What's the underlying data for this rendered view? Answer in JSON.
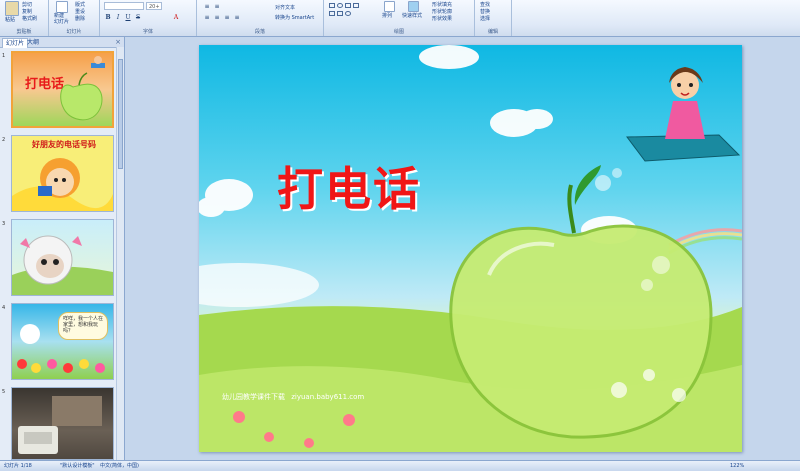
{
  "ribbon": {
    "clipboard": {
      "paste": "粘贴",
      "cut": "剪切",
      "copy": "复制",
      "format_painter": "格式刷",
      "group": "剪贴板"
    },
    "slides": {
      "new_slide": "新建\n幻灯片",
      "layout": "版式",
      "reset": "重设",
      "delete": "删除",
      "group": "幻灯片"
    },
    "font": {
      "font_size": "20+",
      "group": "字体"
    },
    "paragraph": {
      "align_text": "对齐文本",
      "smartart": "转换为 SmartArt",
      "group": "段落"
    },
    "drawing": {
      "arrange": "排列",
      "quick_styles": "快速样式",
      "shape_fill": "形状填充",
      "shape_outline": "形状轮廓",
      "shape_effects": "形状效果",
      "group": "绘图"
    },
    "editing": {
      "find": "查找",
      "replace": "替换",
      "select": "选择",
      "group": "编辑"
    }
  },
  "panel": {
    "tabs": [
      "幻灯片",
      "大纲"
    ],
    "close": "×",
    "slides": [
      {
        "num": "1",
        "title": "打电话"
      },
      {
        "num": "2",
        "caption": "好朋友的电话号码"
      },
      {
        "num": "3"
      },
      {
        "num": "4",
        "bubble": "咩咩，我一个人在家里，想和我玩吗？"
      },
      {
        "num": "5"
      }
    ]
  },
  "slide": {
    "title": "打电话",
    "credit_text": "幼儿园教学课件下载",
    "credit_url": "ziyuan.baby611.com"
  },
  "status": {
    "slide_info": "幻灯片 1/18",
    "theme": "\"默认设计模板\"",
    "language": "中文(简体，中国)",
    "zoom": "122%"
  },
  "colors": {
    "title": "#f01616",
    "selection": "#f2a33a",
    "ribbon": "#dfe9f7"
  }
}
